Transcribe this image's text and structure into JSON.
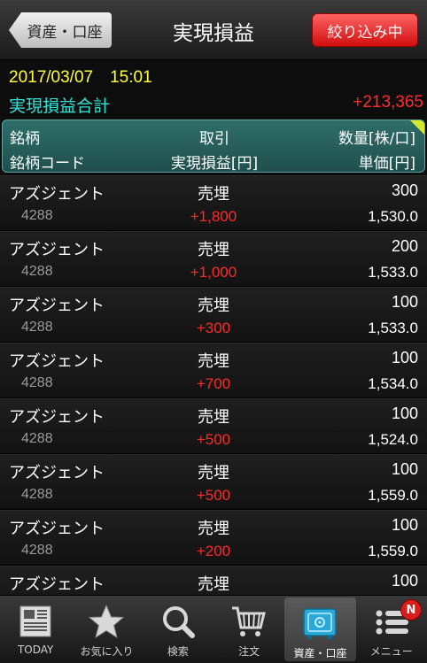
{
  "header": {
    "back_label": "資産・口座",
    "title": "実現損益",
    "filter_label": "絞り込み中"
  },
  "summary": {
    "datetime": "2017/03/07　15:01",
    "total_label": "実現損益合計",
    "total_value": "+213,365"
  },
  "columns": {
    "name": "銘柄",
    "code": "銘柄コード",
    "trade": "取引",
    "pl": "実現損益[円]",
    "qty": "数量[株/口]",
    "price": "単価[円]"
  },
  "rows": [
    {
      "name": "アズジェント",
      "code": "4288",
      "trade": "売埋",
      "pl": "+1,800",
      "qty": "300",
      "price": "1,530.0"
    },
    {
      "name": "アズジェント",
      "code": "4288",
      "trade": "売埋",
      "pl": "+1,000",
      "qty": "200",
      "price": "1,533.0"
    },
    {
      "name": "アズジェント",
      "code": "4288",
      "trade": "売埋",
      "pl": "+300",
      "qty": "100",
      "price": "1,533.0"
    },
    {
      "name": "アズジェント",
      "code": "4288",
      "trade": "売埋",
      "pl": "+700",
      "qty": "100",
      "price": "1,534.0"
    },
    {
      "name": "アズジェント",
      "code": "4288",
      "trade": "売埋",
      "pl": "+500",
      "qty": "100",
      "price": "1,524.0"
    },
    {
      "name": "アズジェント",
      "code": "4288",
      "trade": "売埋",
      "pl": "+500",
      "qty": "100",
      "price": "1,559.0"
    },
    {
      "name": "アズジェント",
      "code": "4288",
      "trade": "売埋",
      "pl": "+200",
      "qty": "100",
      "price": "1,559.0"
    },
    {
      "name": "アズジェント",
      "code": "",
      "trade": "売埋",
      "pl": "",
      "qty": "100",
      "price": ""
    }
  ],
  "tabs": [
    {
      "label": "TODAY",
      "icon": "newspaper-icon"
    },
    {
      "label": "お気に入り",
      "icon": "star-icon"
    },
    {
      "label": "検索",
      "icon": "search-icon"
    },
    {
      "label": "注文",
      "icon": "cart-icon"
    },
    {
      "label": "資産・口座",
      "icon": "safe-icon",
      "active": true
    },
    {
      "label": "メニュー",
      "icon": "menu-icon",
      "badge": "N"
    }
  ],
  "colors": {
    "datetime": "#ffff33",
    "total_label": "#2fe3d7",
    "profit": "#ff2a2a",
    "filter": "#e01818",
    "header_band": "#2f6e6a"
  }
}
